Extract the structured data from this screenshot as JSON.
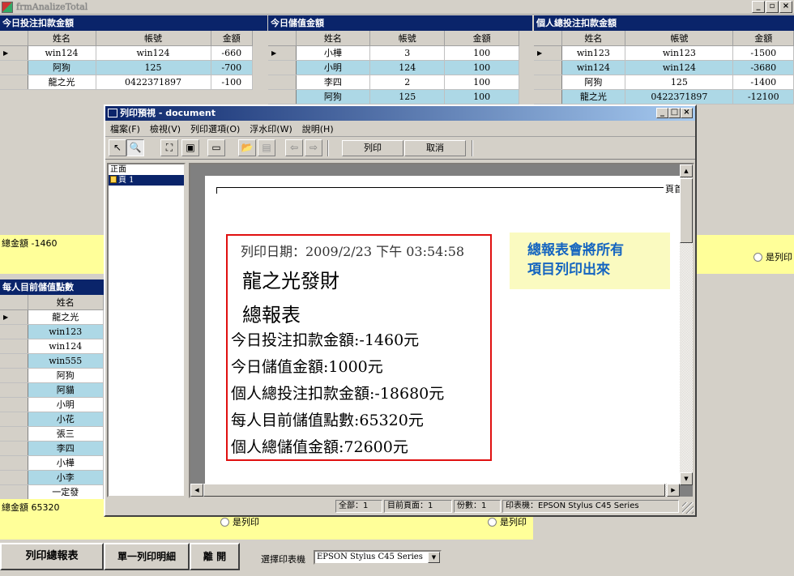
{
  "window": {
    "title": "frmAnalizeTotal",
    "controls": [
      "_",
      "▫",
      "×"
    ]
  },
  "panels": {
    "daily_bet": {
      "title": "今日投注扣款金額",
      "columns": [
        "姓名",
        "帳號",
        "金額"
      ],
      "rows": [
        [
          "win124",
          "win124",
          "-660"
        ],
        [
          "阿狗",
          "125",
          "-700"
        ],
        [
          "龍之光",
          "0422371897",
          "-100"
        ]
      ]
    },
    "daily_deposit": {
      "title": "今日儲值金額",
      "columns": [
        "姓名",
        "帳號",
        "金額"
      ],
      "rows": [
        [
          "小樺",
          "3",
          "100"
        ],
        [
          "小明",
          "124",
          "100"
        ],
        [
          "李四",
          "2",
          "100"
        ],
        [
          "阿狗",
          "125",
          "100"
        ]
      ]
    },
    "personal_bet": {
      "title": "個人總投注扣款金額",
      "columns": [
        "姓名",
        "帳號",
        "金額"
      ],
      "rows": [
        [
          "win123",
          "win123",
          "-1500"
        ],
        [
          "win124",
          "win124",
          "-3680"
        ],
        [
          "阿狗",
          "125",
          "-1400"
        ],
        [
          "龍之光",
          "0422371897",
          "-12100"
        ]
      ]
    },
    "points": {
      "title": "每人目前儲值點數",
      "columns": [
        "姓名"
      ],
      "rows": [
        "龍之光",
        "win123",
        "win124",
        "win555",
        "阿狗",
        "阿貓",
        "小明",
        "小花",
        "張三",
        "李四",
        "小樺",
        "小李",
        "一定發"
      ]
    }
  },
  "totals": {
    "bet_total": "總金額 -1460",
    "points_total": "總金額 65320"
  },
  "radios": {
    "print_label_partial": "是列印",
    "print_label_1": "是列印",
    "print_label_2": "是列印"
  },
  "bottom": {
    "print_summary": "列印總報表",
    "print_detail": "單一列印明細",
    "leave": "離 開",
    "printer_label": "選擇印表機",
    "printer_value": "EPSON Stylus C45 Series"
  },
  "dialog": {
    "title": "列印預視 - document",
    "menu": [
      "檔案(F)",
      "檢視(V)",
      "列印選項(O)",
      "浮水印(W)",
      "說明(H)"
    ],
    "print_btn": "列印",
    "cancel_btn": "取消",
    "tree_root": "正面",
    "tree_page": "頁 1",
    "page_label": "頁首",
    "report": {
      "date": "列印日期：2009/2/23 下午 03:54:58",
      "company": "龍之光發財",
      "title": "總報表",
      "lines": [
        "今日投注扣款金額:-1460元",
        "今日儲值金額:1000元",
        "個人總投注扣款金額:-18680元",
        "每人目前儲值點數:65320元",
        "個人總儲值金額:72600元"
      ]
    },
    "callout": [
      "總報表會將所有",
      "項目列印出來"
    ],
    "status": {
      "total": "全部：1",
      "current": "目前頁面：1",
      "copies": "份數：1",
      "printer": "印表機：EPSON Stylus C45 Series"
    }
  }
}
